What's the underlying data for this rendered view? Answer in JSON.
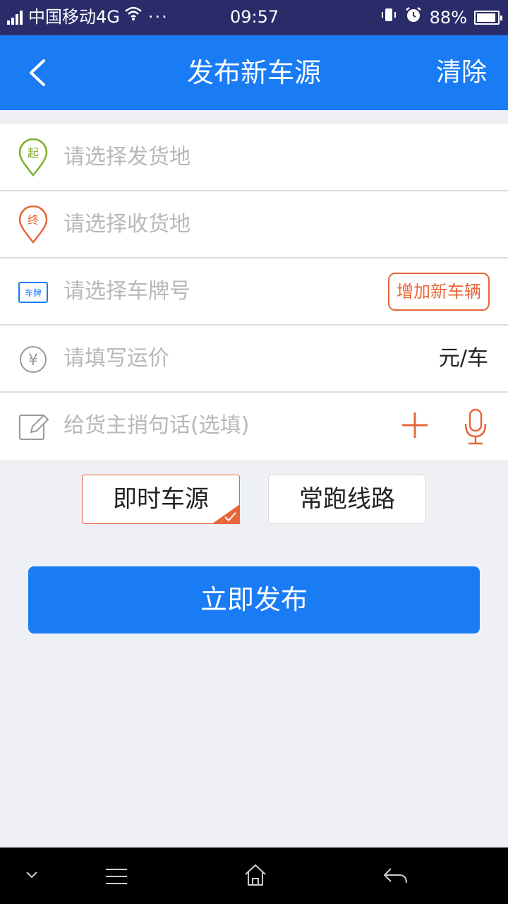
{
  "status_bar": {
    "carrier": "中国移动4G",
    "time": "09:57",
    "battery": "88%",
    "icons": [
      "signal-icon",
      "wifi-icon",
      "more-icon",
      "vibrate-icon",
      "alarm-icon",
      "battery-icon"
    ]
  },
  "header": {
    "title": "发布新车源",
    "clear_label": "清除",
    "accent_color": "#1a7cf5"
  },
  "form": {
    "origin": {
      "icon_text": "起",
      "placeholder": "请选择发货地",
      "icon_color": "#7ab02b"
    },
    "destination": {
      "icon_text": "终",
      "placeholder": "请选择收货地",
      "icon_color": "#e8663a"
    },
    "plate": {
      "icon_text": "车牌",
      "placeholder": "请选择车牌号",
      "add_button": "增加新车辆"
    },
    "price": {
      "icon_text": "¥",
      "placeholder": "请填写运价",
      "unit": "元/车"
    },
    "message": {
      "placeholder": "给货主捎句话(选填)"
    }
  },
  "types": {
    "instant": "即时车源",
    "regular": "常跑线路",
    "selected": "instant"
  },
  "publish_label": "立即发布"
}
